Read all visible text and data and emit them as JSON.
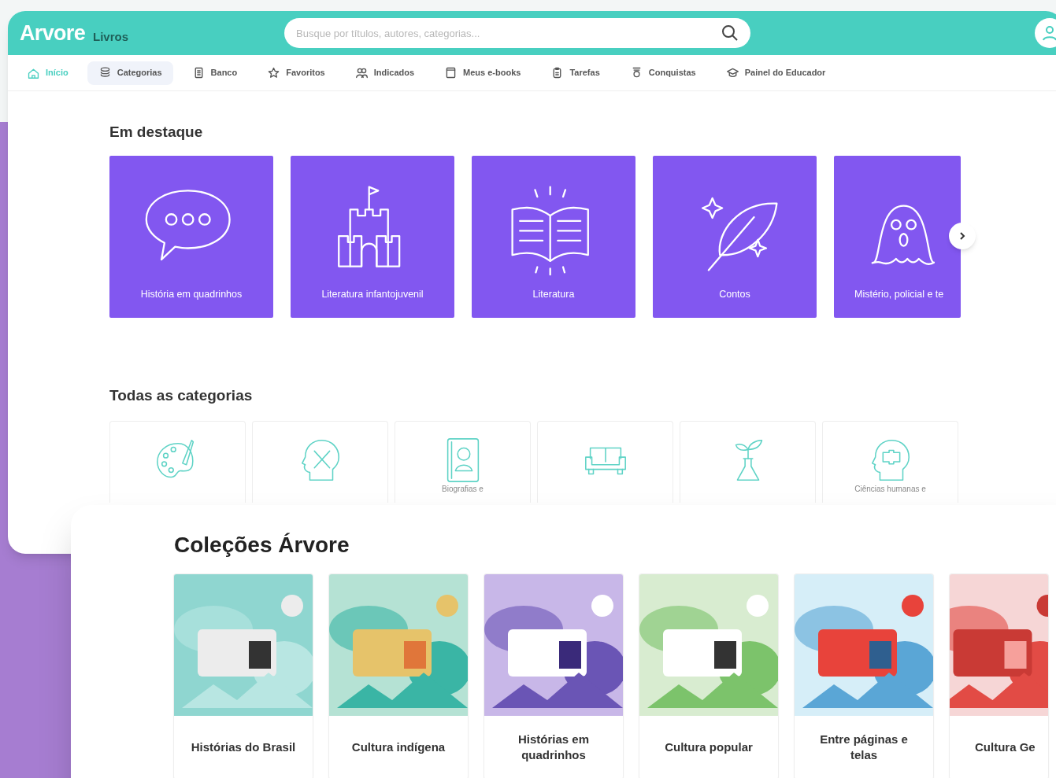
{
  "header": {
    "logo": "Arvore",
    "product": "Livros",
    "search": {
      "placeholder": "Busque por títulos, autores, categorias..."
    }
  },
  "nav": [
    {
      "label": "Início",
      "selected": true,
      "hovered": false
    },
    {
      "label": "Categorias",
      "selected": false,
      "hovered": true
    },
    {
      "label": "Banco",
      "selected": false,
      "hovered": false
    },
    {
      "label": "Favoritos",
      "selected": false,
      "hovered": false
    },
    {
      "label": "Indicados",
      "selected": false,
      "hovered": false
    },
    {
      "label": "Meus e-books",
      "selected": false,
      "hovered": false
    },
    {
      "label": "Tarefas",
      "selected": false,
      "hovered": false
    },
    {
      "label": "Conquistas",
      "selected": false,
      "hovered": false
    },
    {
      "label": "Painel do Educador",
      "selected": false,
      "hovered": false
    }
  ],
  "featured": {
    "title": "Em destaque",
    "items": [
      {
        "label": "História em quadrinhos"
      },
      {
        "label": "Literatura infantojuvenil"
      },
      {
        "label": "Literatura"
      },
      {
        "label": "Contos"
      },
      {
        "label": "Mistério, policial e te"
      }
    ]
  },
  "all_categories": {
    "title": "Todas as categorias",
    "items": [
      {
        "kind": "icon-only"
      },
      {
        "kind": "icon-only"
      },
      {
        "kind": "labelled",
        "label": "Biografias e"
      },
      {
        "kind": "icon-only"
      },
      {
        "kind": "icon-only"
      },
      {
        "kind": "labelled",
        "label": "Ciências humanas e"
      }
    ]
  },
  "collections": {
    "title": "Coleções Árvore",
    "items": [
      {
        "label": "Histórias do Brasil"
      },
      {
        "label": "Cultura indígena"
      },
      {
        "label": "Histórias em quadrinhos"
      },
      {
        "label": "Cultura popular"
      },
      {
        "label": "Entre páginas e telas"
      },
      {
        "label": "Cultura Ge"
      }
    ]
  }
}
